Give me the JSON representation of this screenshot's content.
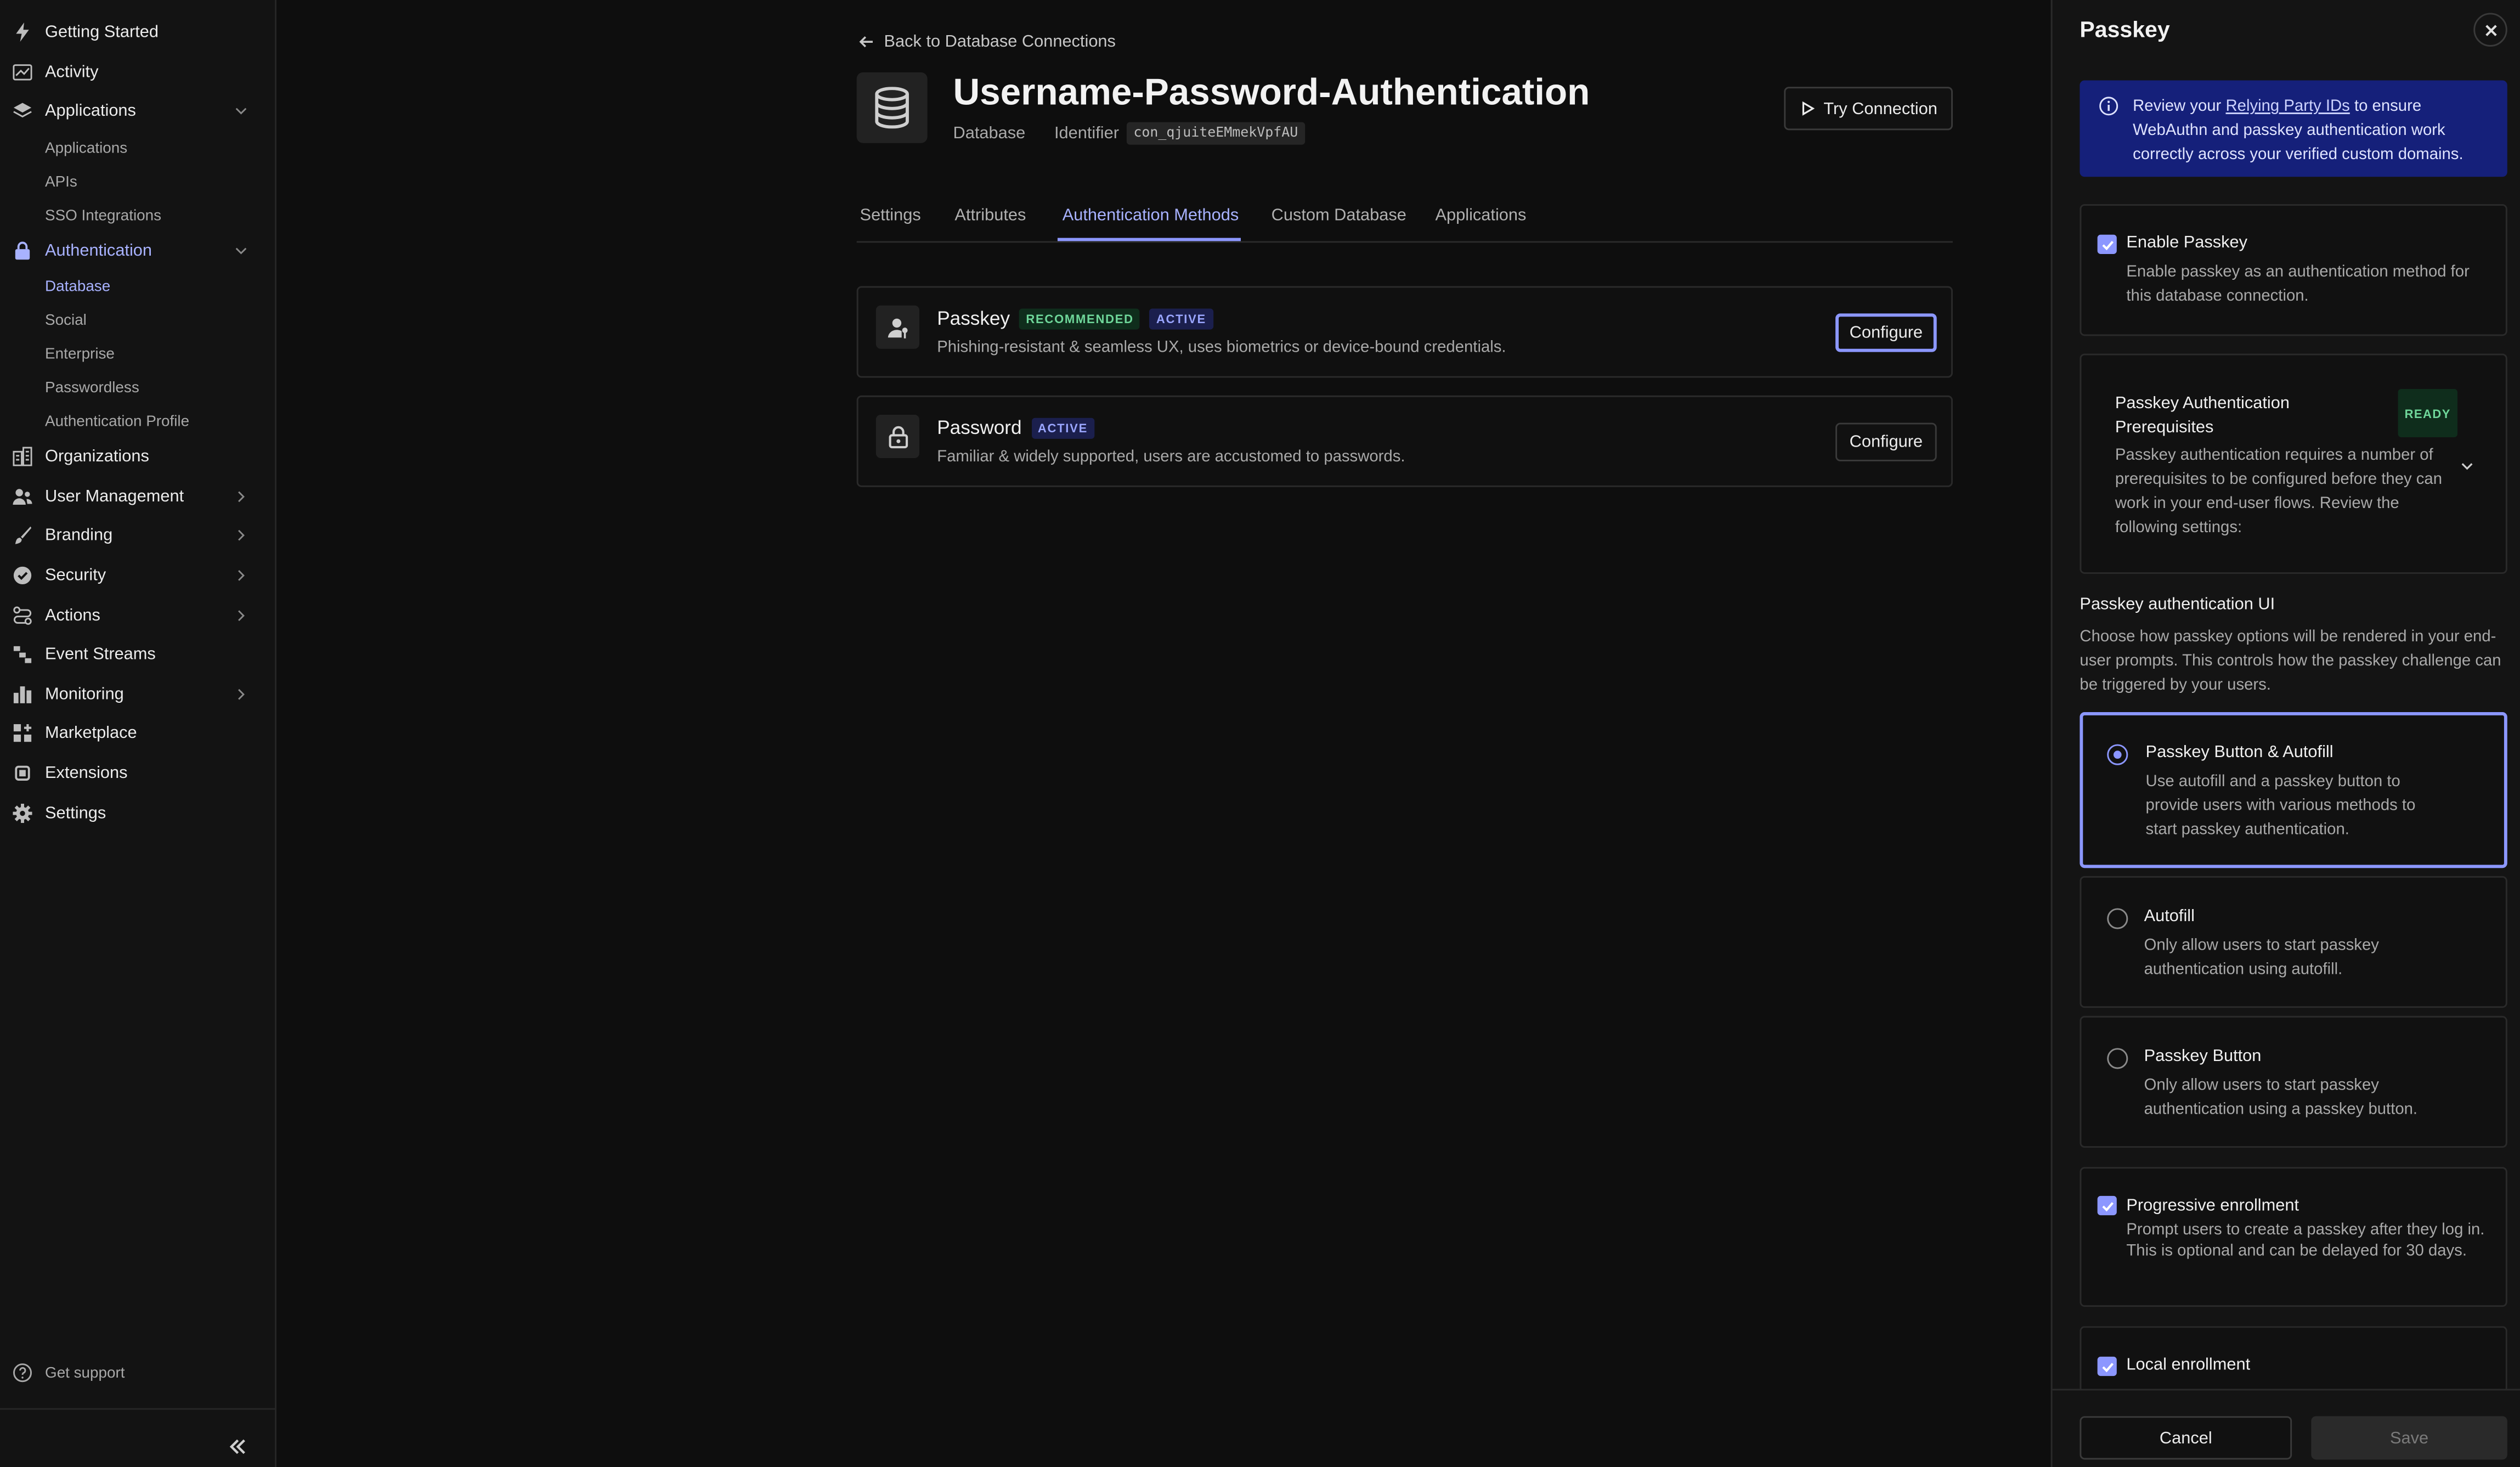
{
  "sidebar": {
    "items": [
      {
        "label": "Getting Started",
        "icon": "bolt-icon"
      },
      {
        "label": "Activity",
        "icon": "activity-chart-icon"
      },
      {
        "label": "Applications",
        "icon": "layers-icon"
      },
      {
        "label": "Authentication",
        "icon": "lock-icon"
      },
      {
        "label": "Organizations",
        "icon": "buildings-icon"
      },
      {
        "label": "User Management",
        "icon": "users-icon"
      },
      {
        "label": "Branding",
        "icon": "brush-icon"
      },
      {
        "label": "Security",
        "icon": "shield-check-icon"
      },
      {
        "label": "Actions",
        "icon": "flow-icon"
      },
      {
        "label": "Event Streams",
        "icon": "stream-icon"
      },
      {
        "label": "Monitoring",
        "icon": "bar-chart-icon"
      },
      {
        "label": "Marketplace",
        "icon": "grid-plus-icon"
      },
      {
        "label": "Extensions",
        "icon": "puzzle-icon"
      },
      {
        "label": "Settings",
        "icon": "gear-icon"
      }
    ],
    "applications_sub": [
      "Applications",
      "APIs",
      "SSO Integrations"
    ],
    "authentication_sub": [
      "Database",
      "Social",
      "Enterprise",
      "Passwordless",
      "Authentication Profile"
    ],
    "support": "Get support"
  },
  "main": {
    "back": "Back to Database Connections",
    "title": "Username-Password-Authentication",
    "type": "Database",
    "identifier_label": "Identifier",
    "identifier": "con_qjuiteEMmekVpfAU",
    "try_button": "Try Connection",
    "tabs": [
      "Settings",
      "Attributes",
      "Authentication Methods",
      "Custom Database",
      "Applications"
    ],
    "methods": [
      {
        "title": "Passkey",
        "badges": [
          "RECOMMENDED",
          "ACTIVE"
        ],
        "description": "Phishing-resistant & seamless UX, uses biometrics or device-bound credentials.",
        "button": "Configure"
      },
      {
        "title": "Password",
        "badges": [
          "ACTIVE"
        ],
        "description": "Familiar & widely supported, users are accustomed to passwords.",
        "button": "Configure"
      }
    ]
  },
  "drawer": {
    "title": "Passkey",
    "info_pre": "Review your ",
    "info_link": "Relying Party IDs",
    "info_post": " to ensure WebAuthn and passkey authentication work correctly across your verified custom domains.",
    "enable": {
      "title": "Enable Passkey",
      "description": "Enable passkey as an authentication method for this database connection."
    },
    "prereq": {
      "title": "Passkey Authentication Prerequisites",
      "badge": "READY",
      "description": "Passkey authentication requires a number of prerequisites to be configured before they can work in your end-user flows. Review the following settings:"
    },
    "ui_heading": "Passkey authentication UI",
    "ui_description": "Choose how passkey options will be rendered in your end-user prompts. This controls how the passkey challenge can be triggered by your users.",
    "options": [
      {
        "title": "Passkey Button & Autofill",
        "description": "Use autofill and a passkey button to provide users with various methods to start passkey authentication."
      },
      {
        "title": "Autofill",
        "description": "Only allow users to start passkey authentication using autofill."
      },
      {
        "title": "Passkey Button",
        "description": "Only allow users to start passkey authentication using a passkey button."
      }
    ],
    "progressive": {
      "title": "Progressive enrollment",
      "description": "Prompt users to create a passkey after they log in. This is optional and can be delayed for 30 days."
    },
    "local": {
      "title": "Local enrollment"
    },
    "cancel": "Cancel",
    "save": "Save"
  },
  "colors": {
    "accent": "#8c97ff",
    "success": "#6fd79a",
    "info_bg": "#15207a"
  }
}
